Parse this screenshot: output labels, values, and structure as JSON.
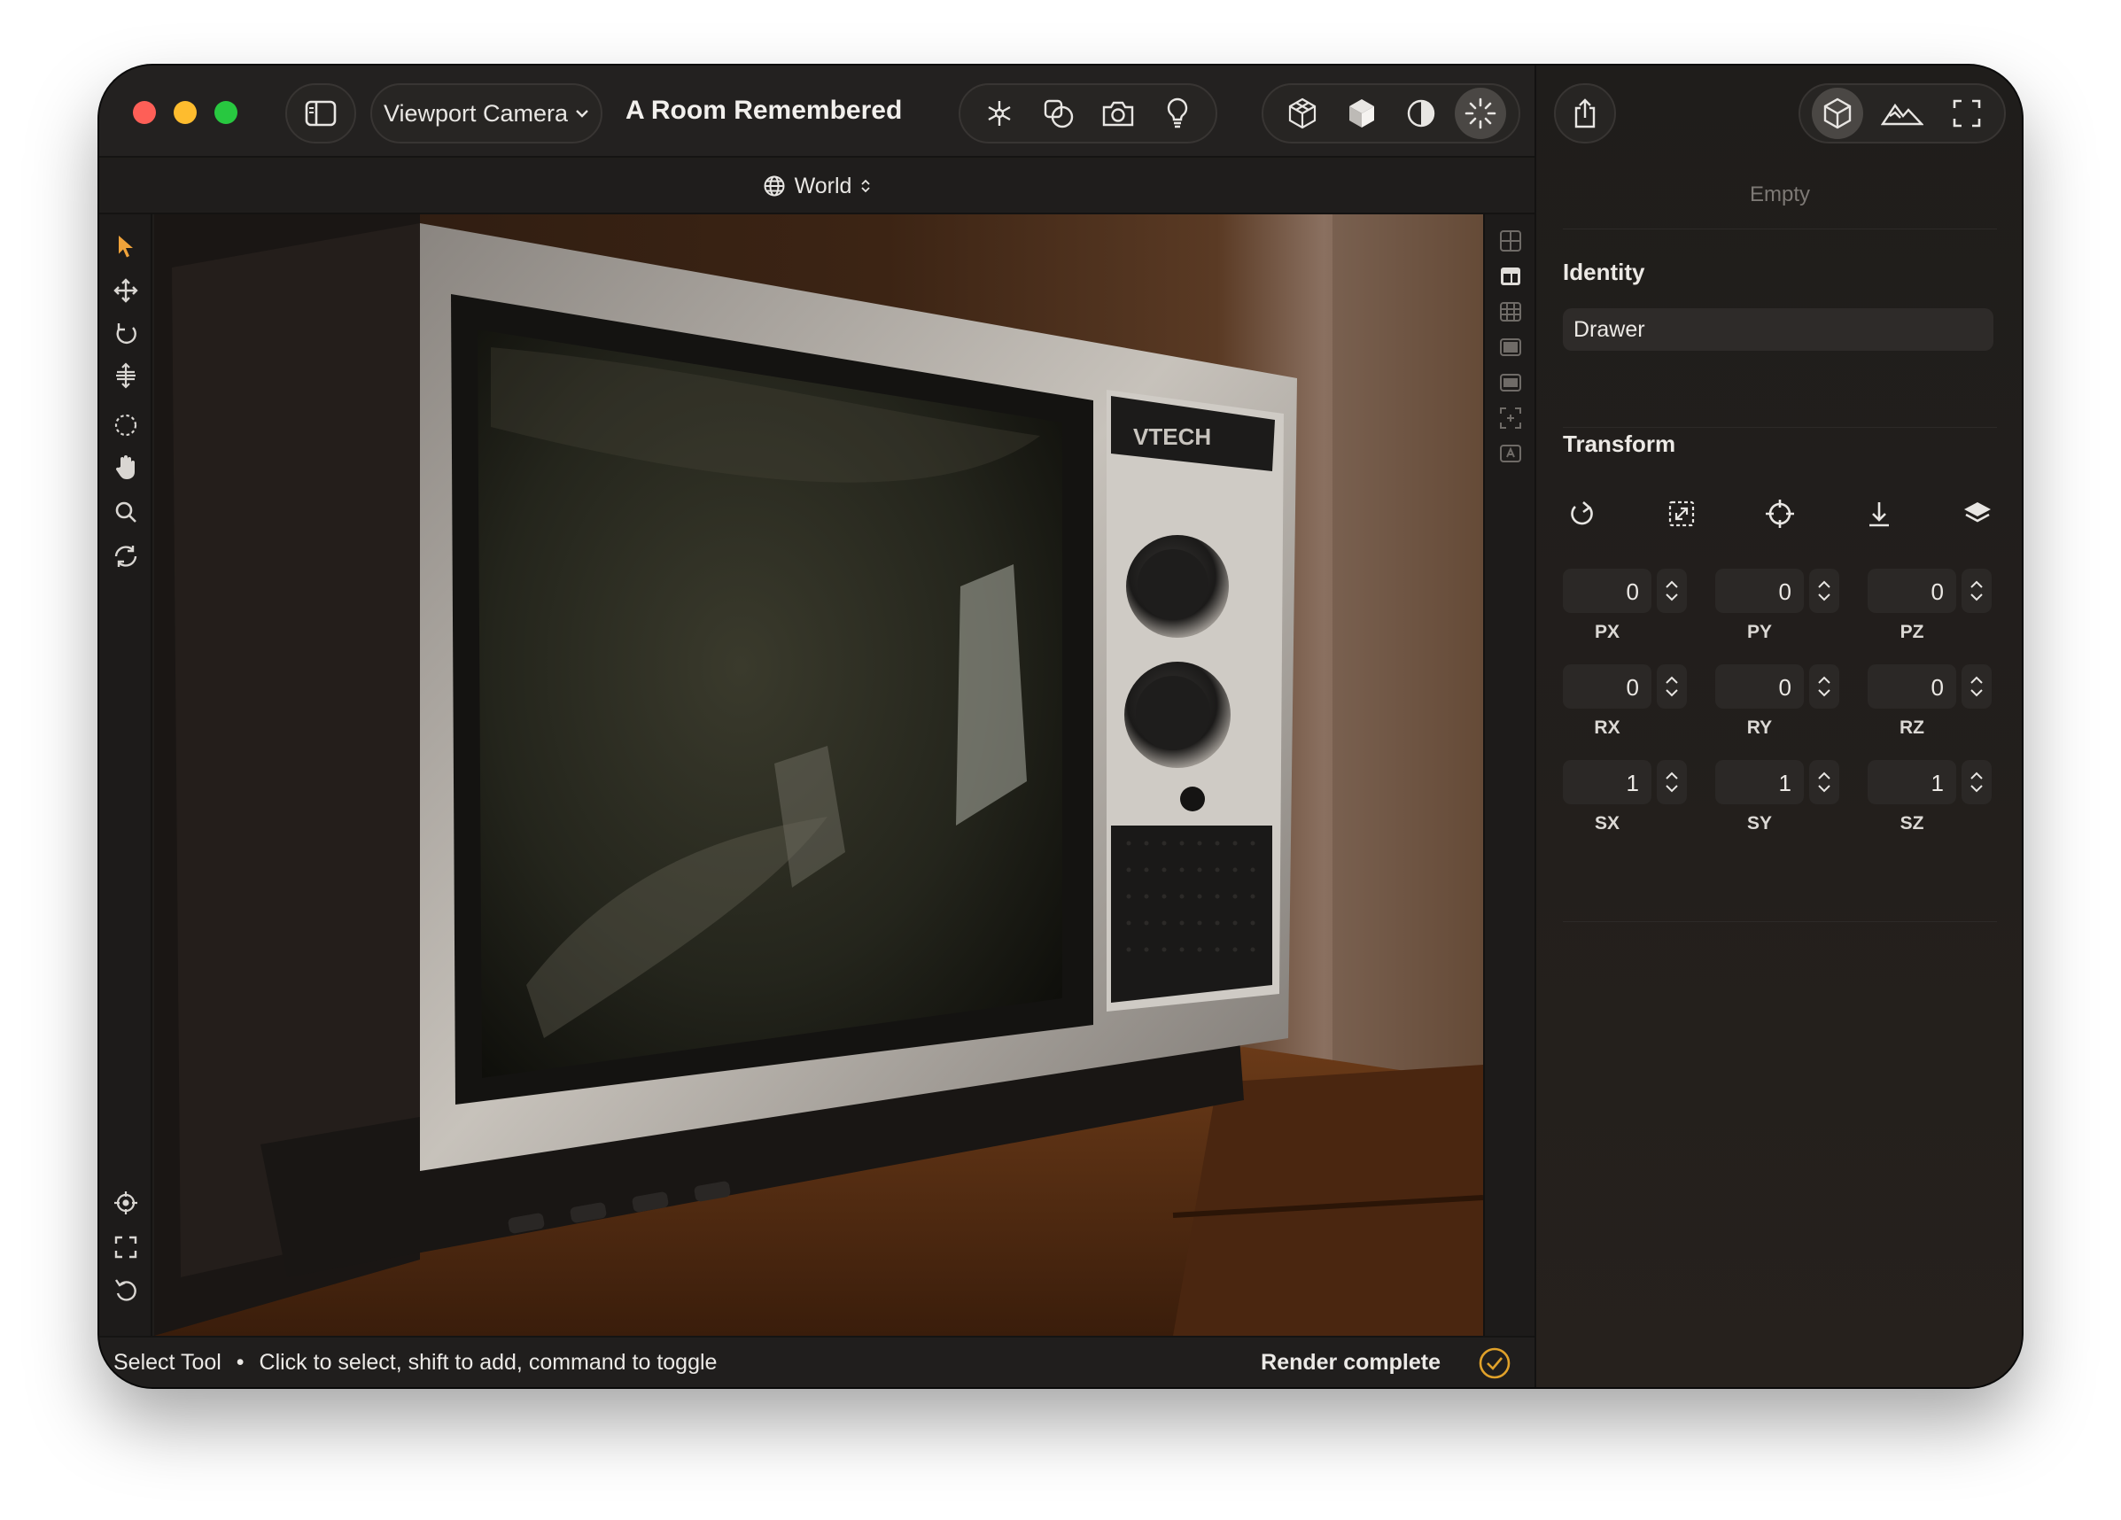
{
  "window": {
    "title": "A Room Remembered",
    "camera_select": "Viewport Camera",
    "coordinate_space": "World"
  },
  "toolbar": {
    "left_icons": [
      "sidebar-toggle-icon"
    ],
    "scene_group": [
      "snowflake-icon",
      "shapes-icon",
      "camera-icon",
      "lightbulb-icon"
    ],
    "render_group": [
      "wireframe-cube-icon",
      "solid-cube-icon",
      "contrast-icon",
      "sparkle-icon"
    ],
    "render_group_active": "sparkle-icon",
    "share_icon": "share-icon",
    "inspector_group": [
      "object-cube-icon",
      "landscape-icon",
      "fullscreen-icon"
    ],
    "inspector_group_active": "object-cube-icon"
  },
  "left_tools": [
    "select-arrow-icon",
    "move-icon",
    "rotate-icon",
    "scale-icon",
    "lasso-icon",
    "hand-icon",
    "zoom-icon",
    "orbit-icon",
    "focus-target-icon",
    "frame-all-icon",
    "reset-view-icon"
  ],
  "right_tools": [
    "grid-layout-icon",
    "split-layout-icon",
    "table-icon",
    "panel-icon",
    "panel-alt-icon",
    "add-frame-icon",
    "text-frame-icon"
  ],
  "statusbar": {
    "tool_name": "Select Tool",
    "separator": "•",
    "hint": "Click to select, shift to add, command to toggle",
    "render_status": "Render complete",
    "accent": "#e0a12a"
  },
  "inspector": {
    "empty_label": "Empty",
    "identity_title": "Identity",
    "name_value": "Drawer",
    "transform_title": "Transform",
    "transform_icons": [
      "reset-transform-icon",
      "resize-icon",
      "crosshair-icon",
      "drop-to-floor-icon",
      "layers-icon"
    ],
    "fields": [
      {
        "label": "PX",
        "value": "0"
      },
      {
        "label": "PY",
        "value": "0"
      },
      {
        "label": "PZ",
        "value": "0"
      },
      {
        "label": "RX",
        "value": "0"
      },
      {
        "label": "RY",
        "value": "0"
      },
      {
        "label": "RZ",
        "value": "0"
      },
      {
        "label": "SX",
        "value": "1"
      },
      {
        "label": "SY",
        "value": "1"
      },
      {
        "label": "SZ",
        "value": "1"
      }
    ]
  },
  "viewport": {
    "brand_text": "VTECH"
  }
}
